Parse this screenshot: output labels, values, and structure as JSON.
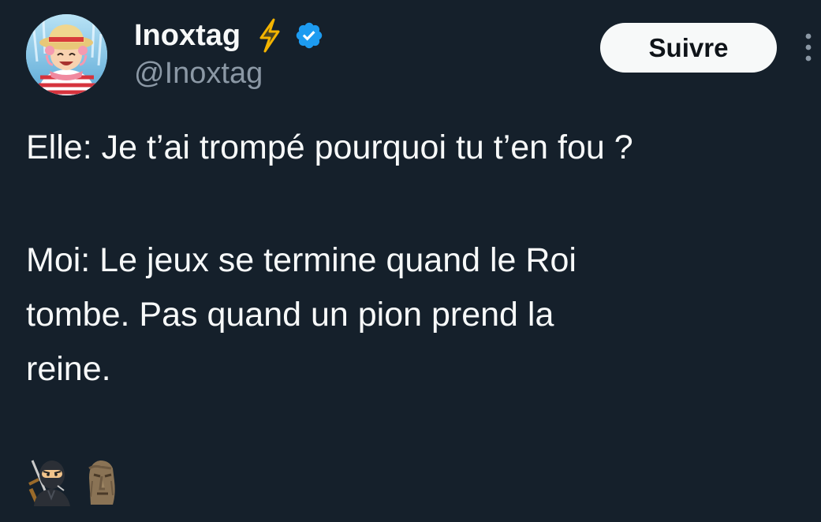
{
  "author": {
    "display_name": "Inoxtag",
    "handle": "@Inoxtag",
    "bolt_icon": "lightning-bolt-icon",
    "verified_icon": "verified-badge-icon",
    "accent_color": "#1d9bf0",
    "bolt_color": "#f4b400"
  },
  "actions": {
    "follow_label": "Suivre",
    "more_icon": "more-vertical-icon"
  },
  "tweet": {
    "line1": "Elle: Je t’ai trompé pourquoi tu t’en fou ?",
    "para2_lines": [
      "Moi: Le jeux se termine quand le Roi",
      "tombe. Pas quand un pion prend la",
      "reine."
    ],
    "emojis": [
      "ninja-emoji",
      "moai-emoji"
    ]
  },
  "theme": {
    "background": "#15202b",
    "text": "#f7f9f9",
    "secondary_text": "#8b98a5"
  }
}
